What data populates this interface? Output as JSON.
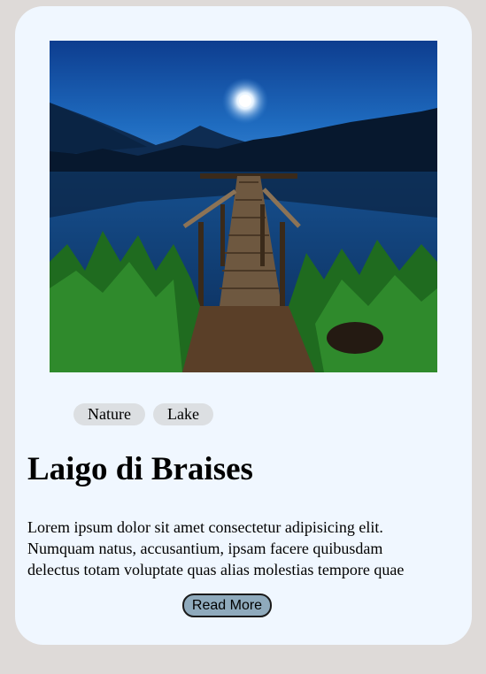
{
  "card": {
    "image_alt": "Night lake with wooden pier under moonlight",
    "tags": [
      "Nature",
      "Lake"
    ],
    "title": "Laigo di Braises",
    "description_lines": [
      "Lorem ipsum dolor sit amet consectetur adipisicing elit.",
      "Numquam natus, accusantium, ipsam facere quibusdam",
      "delectus totam voluptate quas alias molestias tempore quae"
    ],
    "read_more_label": "Read More"
  },
  "colors": {
    "page_background": "#dedad8",
    "card_background": "#f0f7ff",
    "tag_background": "#dcdfe2",
    "button_background": "#8faabc"
  }
}
